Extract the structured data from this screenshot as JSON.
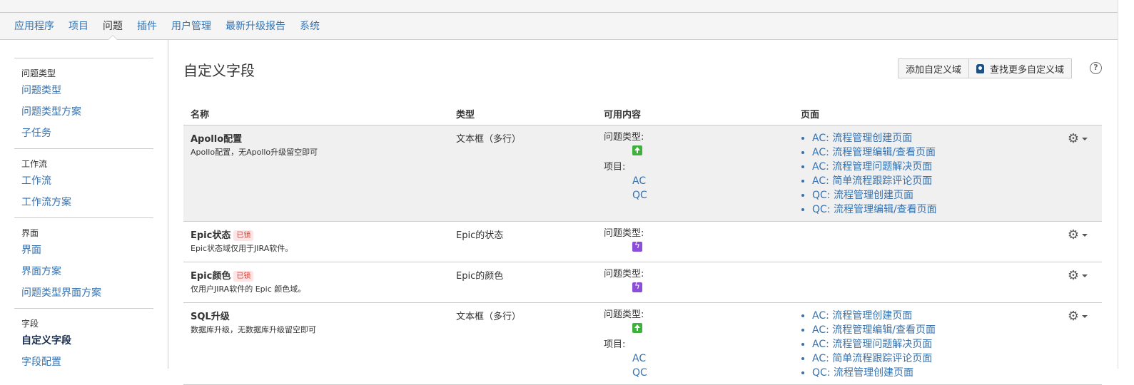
{
  "adminnav": {
    "items": [
      {
        "label": "应用程序"
      },
      {
        "label": "项目"
      },
      {
        "label": "问题"
      },
      {
        "label": "插件"
      },
      {
        "label": "用户管理"
      },
      {
        "label": "最新升级报告"
      },
      {
        "label": "系统"
      }
    ],
    "active": "问题"
  },
  "sidebar": {
    "sections": [
      {
        "title": "问题类型",
        "items": [
          "问题类型",
          "问题类型方案",
          "子任务"
        ]
      },
      {
        "title": "工作流",
        "items": [
          "工作流",
          "工作流方案"
        ]
      },
      {
        "title": "界面",
        "items": [
          "界面",
          "界面方案",
          "问题类型界面方案"
        ]
      },
      {
        "title": "字段",
        "items": [
          "自定义字段",
          "字段配置"
        ]
      }
    ],
    "current": "自定义字段"
  },
  "main": {
    "title": "自定义字段",
    "add_button": "添加自定义域",
    "find_more_button": "查找更多自定义域",
    "help_glyph": "?",
    "columns": {
      "name": "名称",
      "type": "类型",
      "context": "可用内容",
      "screens": "页面"
    },
    "context_labels": {
      "issue_types": "问题类型:",
      "projects": "项目:"
    },
    "locked_label": "已锁",
    "rows": [
      {
        "name": "Apollo配置",
        "description": "Apollo配置，无Apollo升级留空即可",
        "type": "文本框（多行）",
        "issue_type_icon": "improvement-icon",
        "projects": [
          "AC",
          "QC"
        ],
        "screens": [
          "AC: 流程管理创建页面",
          "AC: 流程管理编辑/查看页面",
          "AC: 流程管理问题解决页面",
          "AC: 简单流程跟踪评论页面",
          "QC: 流程管理创建页面",
          "QC: 流程管理编辑/查看页面"
        ]
      },
      {
        "name": "Epic状态",
        "description": "Epic状态域仅用于JIRA软件。",
        "type": "Epic的状态",
        "issue_type_icon": "epic-icon"
      },
      {
        "name": "Epic颜色",
        "description": "仅用户JIRA软件的 Epic 颜色域。",
        "type": "Epic的颜色",
        "issue_type_icon": "epic-icon"
      },
      {
        "name": "SQL升级",
        "description": "数据库升级，无数据库升级留空即可",
        "type": "文本框（多行）",
        "issue_type_icon": "improvement-icon",
        "projects": [
          "AC",
          "QC"
        ],
        "screens": [
          "AC: 流程管理创建页面",
          "AC: 流程管理编辑/查看页面",
          "AC: 流程管理问题解决页面",
          "AC: 简单流程跟踪评论页面",
          "QC: 流程管理创建页面"
        ]
      }
    ]
  },
  "colors": {
    "link": "#3572b0",
    "locked_bg": "#fee4e4",
    "locked_text": "#d04437",
    "improvement": "#3db13c",
    "epic": "#8c4ed8"
  }
}
